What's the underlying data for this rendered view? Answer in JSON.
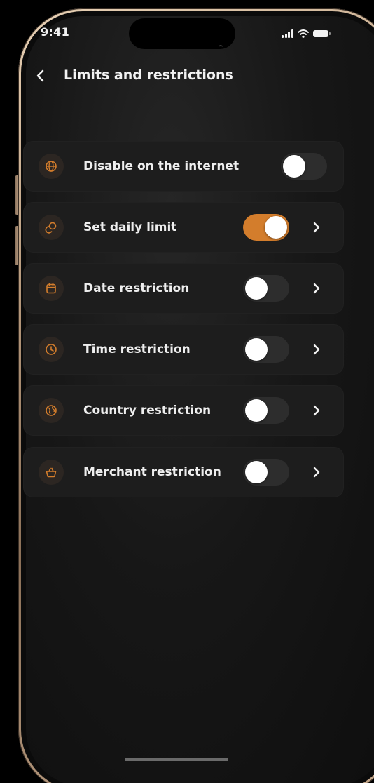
{
  "status_bar": {
    "time": "9:41",
    "icons": [
      "cellular-signal-icon",
      "wifi-icon",
      "battery-icon"
    ]
  },
  "header": {
    "back_icon": "chevron-left-icon",
    "title": "Limits and restrictions"
  },
  "colors": {
    "accent": "#d37d2c",
    "toggle_off": "#2d2d2d",
    "row_bg": "#1d1d1d",
    "icon_bg": "#2c2622"
  },
  "settings": [
    {
      "label": "Disable on the internet",
      "icon": "globe-icon",
      "enabled": false,
      "has_chevron": false
    },
    {
      "label": "Set daily limit",
      "icon": "coins-icon",
      "enabled": true,
      "has_chevron": true
    },
    {
      "label": "Date restriction",
      "icon": "calendar-icon",
      "enabled": false,
      "has_chevron": true
    },
    {
      "label": "Time restriction",
      "icon": "clock-icon",
      "enabled": false,
      "has_chevron": true
    },
    {
      "label": "Country restriction",
      "icon": "globe-pin-icon",
      "enabled": false,
      "has_chevron": true
    },
    {
      "label": "Merchant restriction",
      "icon": "basket-icon",
      "enabled": false,
      "has_chevron": true
    }
  ]
}
